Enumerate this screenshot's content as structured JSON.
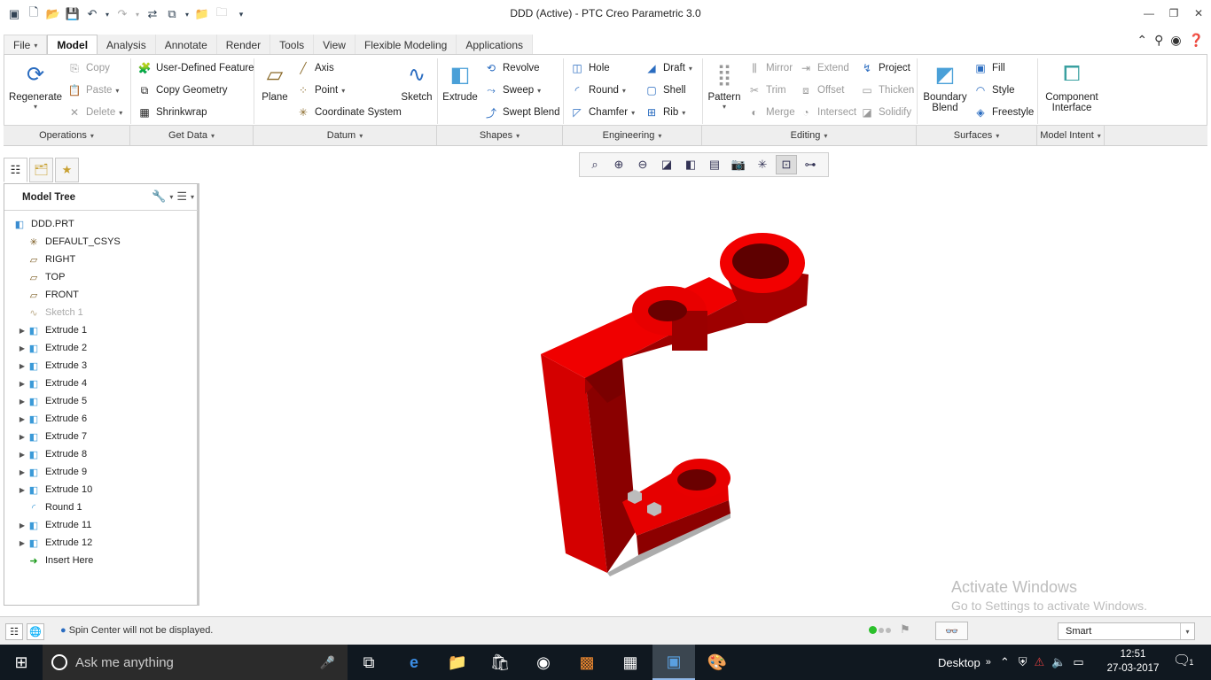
{
  "window": {
    "title": "DDD (Active) - PTC Creo Parametric 3.0"
  },
  "tabs": [
    {
      "label": "File"
    },
    {
      "label": "Model"
    },
    {
      "label": "Analysis"
    },
    {
      "label": "Annotate"
    },
    {
      "label": "Render"
    },
    {
      "label": "Tools"
    },
    {
      "label": "View"
    },
    {
      "label": "Flexible Modeling"
    },
    {
      "label": "Applications"
    }
  ],
  "ribbon": {
    "regenerate": "Regenerate",
    "copy": "Copy",
    "paste": "Paste",
    "delete": "Delete",
    "user_defined_feature": "User-Defined Feature",
    "copy_geometry": "Copy Geometry",
    "shrinkwrap": "Shrinkwrap",
    "plane": "Plane",
    "axis": "Axis",
    "point": "Point",
    "coordinate_system": "Coordinate System",
    "sketch": "Sketch",
    "extrude": "Extrude",
    "revolve": "Revolve",
    "sweep": "Sweep",
    "swept_blend": "Swept Blend",
    "hole": "Hole",
    "round": "Round",
    "chamfer": "Chamfer",
    "draft": "Draft",
    "shell": "Shell",
    "rib": "Rib",
    "pattern": "Pattern",
    "mirror": "Mirror",
    "trim": "Trim",
    "merge": "Merge",
    "extend": "Extend",
    "offset": "Offset",
    "intersect": "Intersect",
    "project": "Project",
    "thicken": "Thicken",
    "solidify": "Solidify",
    "boundary_blend_1": "Boundary",
    "boundary_blend_2": "Blend",
    "fill": "Fill",
    "style": "Style",
    "freestyle": "Freestyle",
    "component_interface_1": "Component",
    "component_interface_2": "Interface"
  },
  "groups": [
    {
      "label": "Operations"
    },
    {
      "label": "Get Data"
    },
    {
      "label": "Datum"
    },
    {
      "label": "Shapes"
    },
    {
      "label": "Engineering"
    },
    {
      "label": "Editing"
    },
    {
      "label": "Surfaces"
    },
    {
      "label": "Model Intent"
    }
  ],
  "model_tree": {
    "title": "Model Tree",
    "items": [
      {
        "label": "DDD.PRT",
        "icon": "part-icon"
      },
      {
        "label": "DEFAULT_CSYS",
        "icon": "csys-icon"
      },
      {
        "label": "RIGHT",
        "icon": "datum-plane-icon"
      },
      {
        "label": "TOP",
        "icon": "datum-plane-icon"
      },
      {
        "label": "FRONT",
        "icon": "datum-plane-icon"
      },
      {
        "label": "Sketch 1",
        "icon": "sketch-icon"
      },
      {
        "label": "Extrude 1",
        "icon": "extrude-icon"
      },
      {
        "label": "Extrude 2",
        "icon": "extrude-icon"
      },
      {
        "label": "Extrude 3",
        "icon": "extrude-icon"
      },
      {
        "label": "Extrude 4",
        "icon": "extrude-icon"
      },
      {
        "label": "Extrude 5",
        "icon": "extrude-icon"
      },
      {
        "label": "Extrude 6",
        "icon": "extrude-icon"
      },
      {
        "label": "Extrude 7",
        "icon": "extrude-icon"
      },
      {
        "label": "Extrude 8",
        "icon": "extrude-icon"
      },
      {
        "label": "Extrude 9",
        "icon": "extrude-icon"
      },
      {
        "label": "Extrude 10",
        "icon": "extrude-icon"
      },
      {
        "label": "Round 1",
        "icon": "round-icon"
      },
      {
        "label": "Extrude 11",
        "icon": "extrude-icon"
      },
      {
        "label": "Extrude 12",
        "icon": "extrude-icon"
      },
      {
        "label": "Insert Here",
        "icon": "insert-arrow-icon"
      }
    ]
  },
  "watermark": {
    "line1": "Activate Windows",
    "line2": "Go to Settings to activate Windows."
  },
  "status": {
    "message": "Spin Center will not be displayed.",
    "filter": "Smart"
  },
  "taskbar": {
    "search_placeholder": "Ask me anything",
    "desktop_label": "Desktop",
    "time": "12:51",
    "date": "27-03-2017",
    "notification_count": "1"
  },
  "colors": {
    "model_red": "#e00000",
    "model_dark_red": "#8c0000",
    "taskbar": "#101820"
  }
}
